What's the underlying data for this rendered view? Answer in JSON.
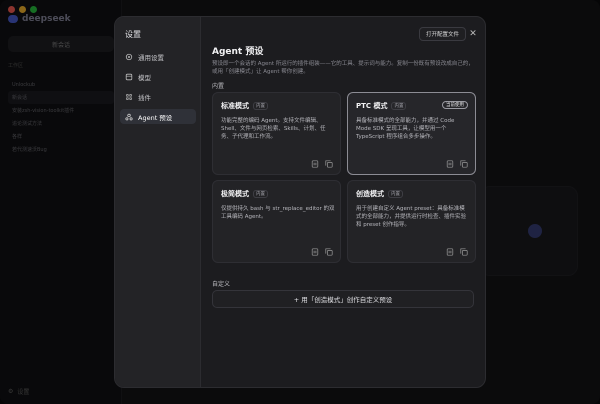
{
  "background": {
    "app_name": "deepseek",
    "app_badge": "",
    "new_chat": "新会话",
    "section": "工作区",
    "list": [
      "Unlockub",
      "新会话",
      "安装zsh-vision-toolkit插件",
      "追论测试方法",
      "各样",
      "若代测速沃Bug"
    ],
    "settings": "设置"
  },
  "dialog": {
    "nav_title": "设置",
    "nav": [
      {
        "label": "通用设置",
        "icon": "gear-icon"
      },
      {
        "label": "模型",
        "icon": "cube-icon"
      },
      {
        "label": "插件",
        "icon": "plugin-icon"
      },
      {
        "label": "Agent 预设",
        "icon": "agent-icon"
      }
    ],
    "open_config_button": "打开配置文件",
    "close": "✕",
    "title": "Agent 预设",
    "description": "预设即一个会话的 Agent 所运行的插件组装——它的工具、提示词与能力。复制一份既有预设改成自己的，或用「创建模式」让 Agent 帮你创建。",
    "builtin_label": "内置",
    "cards": [
      {
        "name": "标准模式",
        "tag": "内置",
        "current": "",
        "description": "功能完整的编码 Agent。支持文件编辑、Shell、文件与网页检索、Skills、计划、任务、子代理和工作流。"
      },
      {
        "name": "PTC 模式",
        "tag": "内置",
        "current": "当前使用",
        "description": "具备标准模式的全部能力，并通过 Code Mode SDK 呈现工具，让模型用一个 TypeScript 程序组合多步操作。"
      },
      {
        "name": "极简模式",
        "tag": "内置",
        "current": "",
        "description": "仅提供持久 bash 与 str_replace_editor 的双工具编码 Agent。"
      },
      {
        "name": "创造模式",
        "tag": "内置",
        "current": "",
        "description": "用于创建自定义 Agent preset：具备标准模式的全部能力，并提供运行时检查、插件实验和 preset 创作指导。"
      }
    ],
    "custom_label": "自定义",
    "custom_button": "+ 用「创造模式」创作自定义预设"
  },
  "colors": {
    "accent": "#4b5fd6",
    "dialog_bg": "#1c1c1f",
    "card_bg": "#232326"
  }
}
